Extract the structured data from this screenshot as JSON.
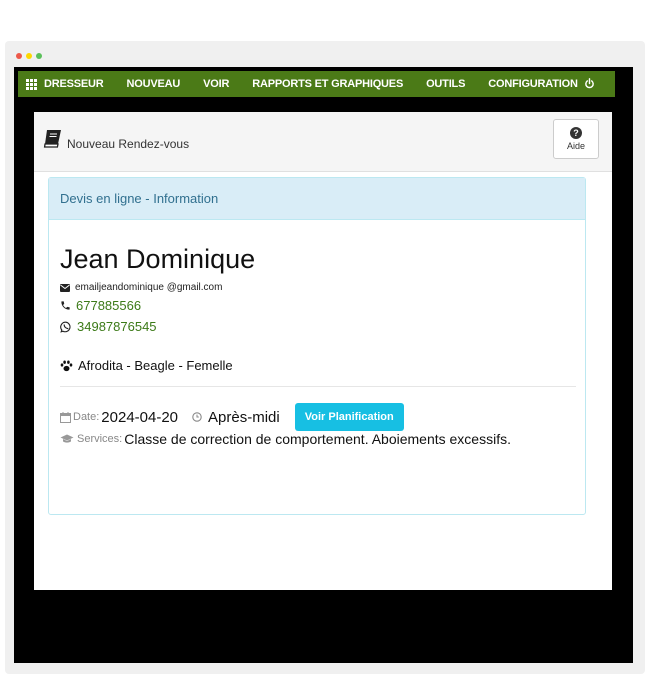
{
  "nav": {
    "brand": "DRESSEUR",
    "items": [
      "NOUVEAU",
      "VOIR",
      "RAPPORTS ET GRAPHIQUES",
      "OUTILS",
      "CONFIGURATION"
    ]
  },
  "panel": {
    "title": "Nouveau Rendez-vous",
    "help_label": "Aide"
  },
  "card": {
    "heading": "Devis en ligne - Information",
    "client": {
      "name": "Jean Dominique",
      "email": "emailjeandominique @gmail.com",
      "phone": "677885566",
      "whatsapp": "34987876545",
      "pet": "Afrodita - Beagle - Femelle"
    },
    "appointment": {
      "date_label": "Date:",
      "date": "2024-04-20",
      "time": "Après-midi",
      "plan_button": "Voir Planification",
      "services_label": "Services:",
      "services": "Classe de correction de comportement. Aboiements excessifs."
    }
  },
  "colors": {
    "navbar": "#4b7a17",
    "accent_green": "#3c7a18",
    "info_bg": "#d9edf7",
    "info_text": "#31708f",
    "button": "#17bfe3"
  },
  "icons": [
    "grid-icon",
    "power-icon",
    "book-icon",
    "help-icon",
    "envelope-icon",
    "phone-icon",
    "whatsapp-icon",
    "paw-icon",
    "calendar-icon",
    "clock-icon",
    "graduation-cap-icon"
  ]
}
